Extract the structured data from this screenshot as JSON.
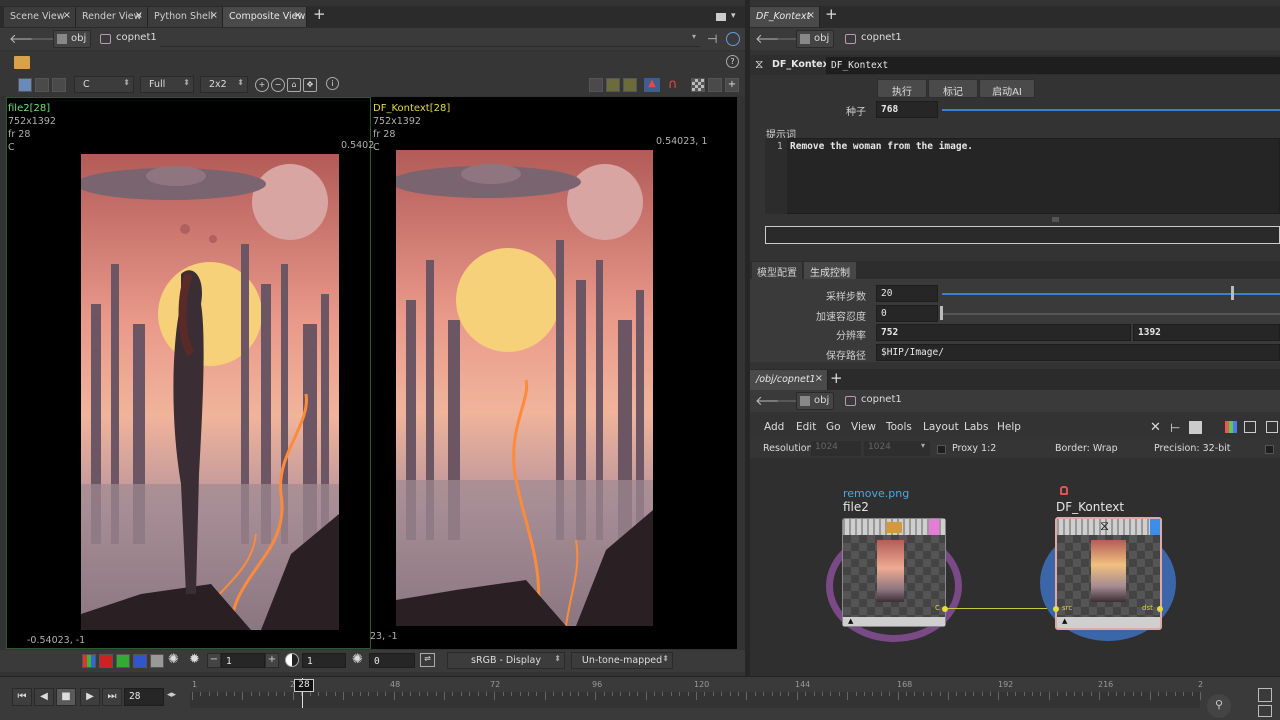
{
  "left_pane": {
    "tabs": [
      "Scene View",
      "Render View",
      "Python Shell",
      "Composite View"
    ],
    "path": {
      "obj": "obj",
      "net": "copnet1"
    },
    "toolbar": {
      "plane": "C",
      "res": "Full",
      "layout": "2x2",
      "info_glyph": "i",
      "help_glyph": "?"
    },
    "viewer_left": {
      "name": "file2[28]",
      "size": "752x1392",
      "frame": "fr 28",
      "plane": "C",
      "corner_tr": "0.5402",
      "corner_bl": "-0.54023, -1",
      "name_color": "#6fe36f"
    },
    "viewer_right": {
      "name": "DF_Kontext[28]",
      "size": "752x1392",
      "frame": "fr 28",
      "plane": "C",
      "corner_tr": "0.54023, 1",
      "corner_bl": "23, -1",
      "name_color": "#e5d84a"
    },
    "bottom": {
      "a": "1",
      "b": "1",
      "c": "0",
      "display": "sRGB - Display",
      "tone": "Un-tone-mapped"
    }
  },
  "param_pane": {
    "tab": "DF_Kontext",
    "path": {
      "obj": "obj",
      "net": "copnet1"
    },
    "node_type": "DF_Kontext",
    "node_name": "DF_Kontext",
    "buttons": [
      "执行",
      "标记",
      "启动AI"
    ],
    "seed_label": "种子",
    "seed": "768",
    "prompt_label": "提示词",
    "prompt_line": "1",
    "prompt_text": "Remove the woman from the image.",
    "subtabs": [
      "模型配置",
      "生成控制"
    ],
    "steps_label": "采样步数",
    "steps": "20",
    "accel_label": "加速容忍度",
    "accel": "0",
    "res_label": "分辨率",
    "res_w": "752",
    "res_h": "1392",
    "save_label": "保存路径",
    "save_path": "$HIP/Image/"
  },
  "network_pane": {
    "tab": "/obj/copnet1",
    "path": {
      "obj": "obj",
      "net": "copnet1"
    },
    "menu": [
      "Add",
      "Edit",
      "Go",
      "View",
      "Tools",
      "Layout",
      "Labs",
      "Help"
    ],
    "info": {
      "resolution_label": "Resolution",
      "res_w": "1024",
      "res_h": "1024",
      "proxy": "Proxy 1:2",
      "border": "Border: Wrap",
      "precision": "Precision: 32-bit"
    },
    "node1": {
      "comment": "remove.png",
      "name": "file2",
      "out": "C"
    },
    "node2": {
      "name": "DF_Kontext",
      "in": "src",
      "out": "dst"
    }
  },
  "timeline": {
    "frame": "28",
    "current_marker": "28",
    "ticks": [
      "1",
      "24",
      "48",
      "72",
      "96",
      "120",
      "144",
      "168",
      "192",
      "216",
      "2"
    ]
  },
  "colors": {
    "accent_blue": "#3d7fd6",
    "node_purple": "#7a4a86",
    "node_blue": "#3b66a8",
    "wire": "#c9c940"
  }
}
